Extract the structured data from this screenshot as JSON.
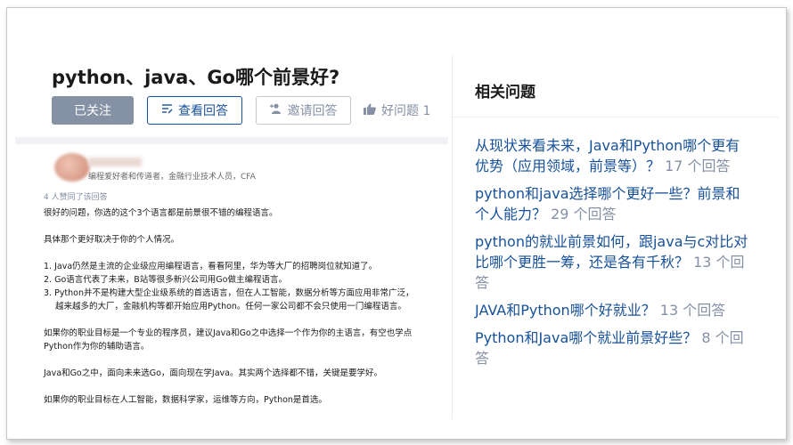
{
  "question": {
    "title": "python、java、Go哪个前景好?",
    "buttons": {
      "follow": "已关注",
      "view_answers": "查看回答",
      "invite": "邀请回答",
      "good_question": "好问题 1"
    }
  },
  "answer": {
    "author_bio": "编程爱好者和传道者，金融行业技术人员，CFA",
    "upvotes": "4 人赞同了该回答",
    "p1": "很好的问题，你选的这个3个语言都是前景很不错的编程语言。",
    "p2": "具体那个更好取决于你的个人情况。",
    "list": [
      "1. Java仍然是主流的企业级应用编程语言，看看阿里，华为等大厂的招聘岗位就知道了。",
      "2. Go语言代表了未来，B站等很多新兴公司用Go做主编程语言。",
      "3. Python并不是构建大型企业级系统的首选语言，但在人工智能，数据分析等方面应用非常广泛，"
    ],
    "list_item3_cont": "越来越多的大厂，金融机构等都开始应用Python。任何一家公司都不会只使用一门编程语言。",
    "p3_line1": "如果你的职业目标是一个专业的程序员，建议Java和Go之中选择一个作为你的主语言，有空也学点",
    "p3_line2": "Python作为你的辅助语言。",
    "p4": "Java和Go之中，面向未来选Go，面向现在学Java。其实两个选择都不错，关键是要学好。",
    "p5": "如果你的职业目标在人工智能，数据科学家，运维等方向，Python是首选。"
  },
  "related": {
    "title": "相关问题",
    "items": [
      {
        "text": "从现状来看未来，Java和Python哪个更有优势（应用领域，前景等）？",
        "count": "17 个回答"
      },
      {
        "text": "python和java选择哪个更好一些？前景和个人能力？",
        "count": "29 个回答"
      },
      {
        "text": "python的就业前景如何，跟java与c对比对比哪个更胜一筹，还是各有千秋？",
        "count": "13 个回答"
      },
      {
        "text": "JAVA和Python哪个好就业？",
        "count": "13 个回答"
      },
      {
        "text": "Python和Java哪个就业前景好些？",
        "count": "8 个回答"
      }
    ]
  },
  "icons": {
    "view_answers": "list-edit-icon",
    "invite": "add-user-icon",
    "good_question": "thumbs-up-icon"
  },
  "colors": {
    "link": "#175199",
    "muted": "#8590a6",
    "followed_button": "#8591a5"
  }
}
